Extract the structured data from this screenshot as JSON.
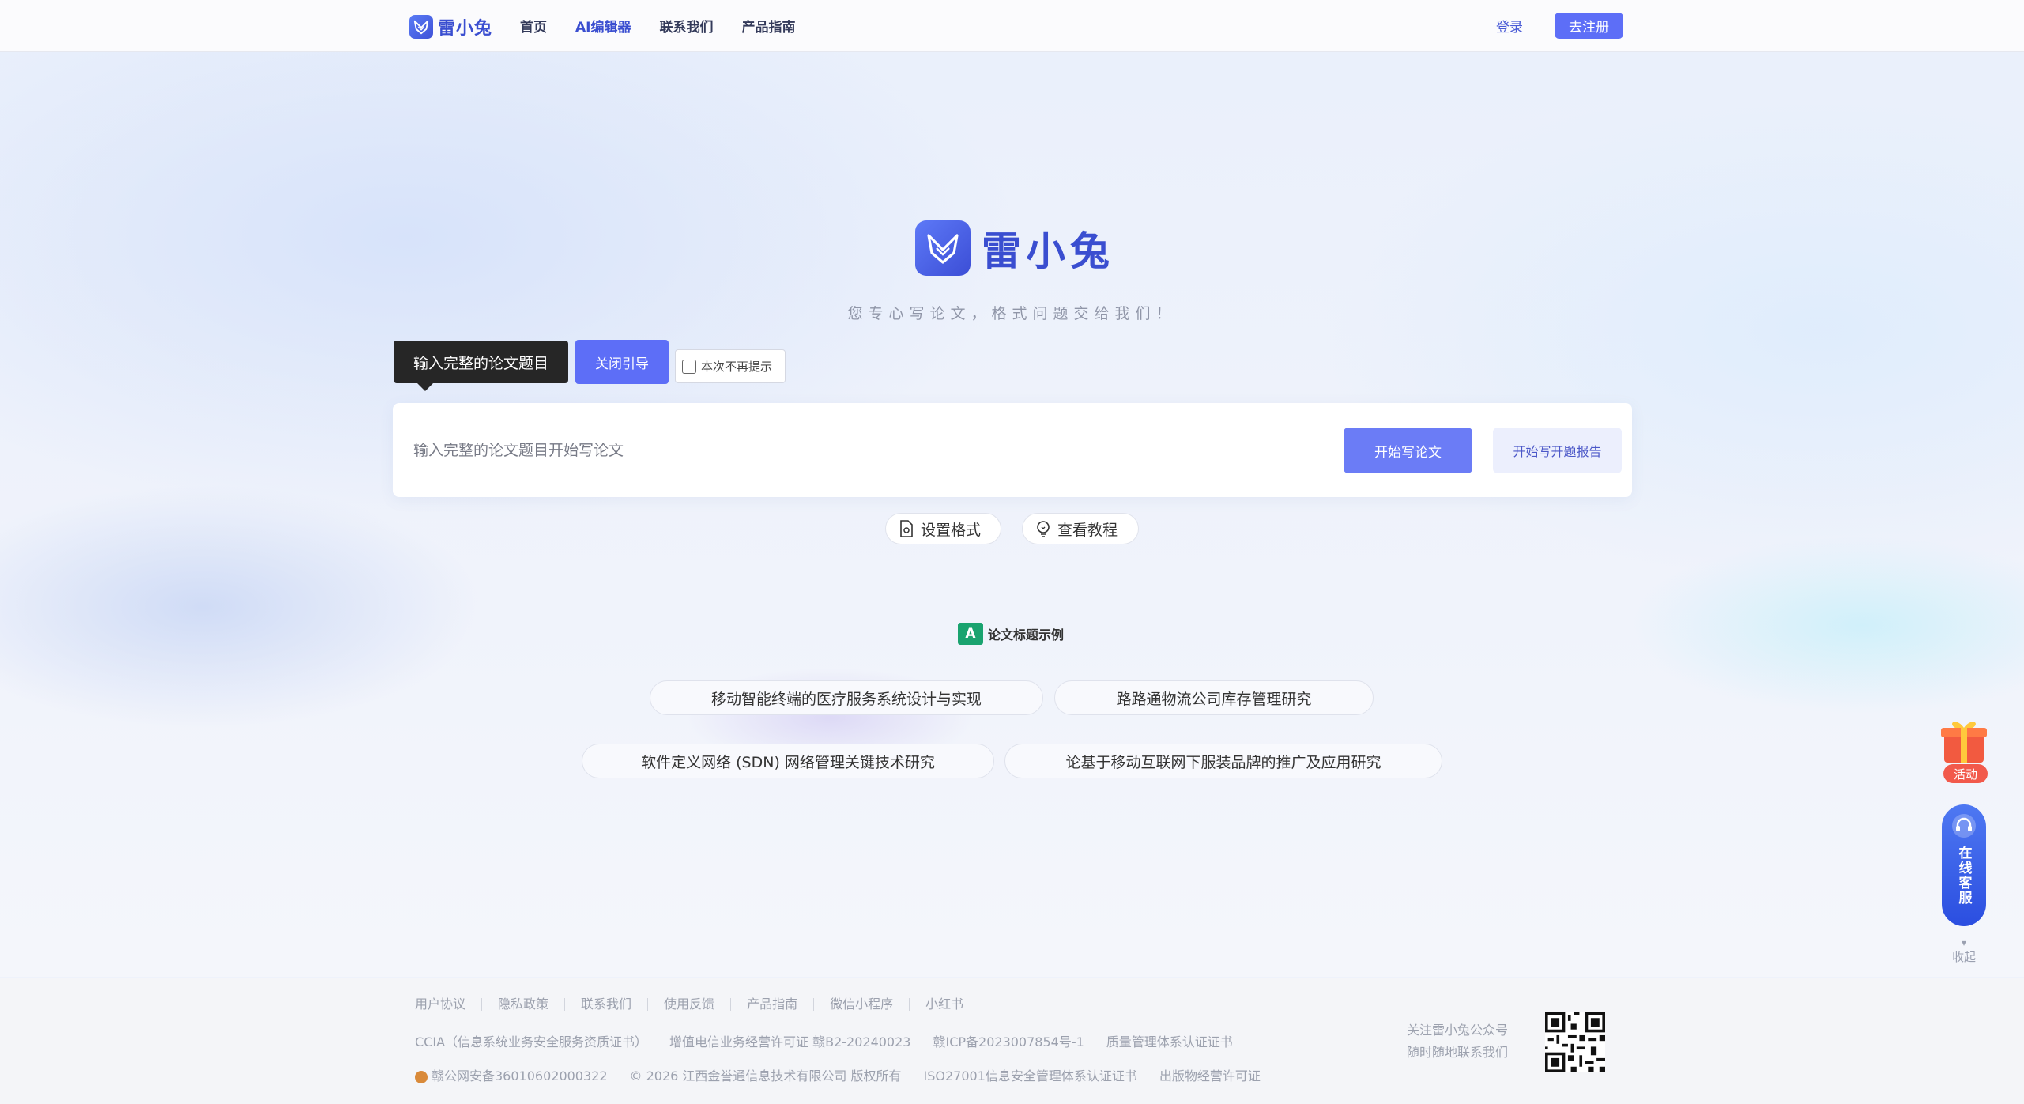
{
  "header": {
    "brand": "雷小兔",
    "nav": [
      {
        "label": "首页",
        "active": false
      },
      {
        "label": "AI编辑器",
        "active": true
      },
      {
        "label": "联系我们",
        "active": false
      },
      {
        "label": "产品指南",
        "active": false
      }
    ],
    "login": "登录",
    "register": "去注册"
  },
  "hero": {
    "brand": "雷小兔",
    "slogan": "您专心写论文，格式问题交给我们！"
  },
  "guide": {
    "tip": "输入完整的论文题目",
    "close": "关闭引导",
    "no_remind": "本次不再提示"
  },
  "search": {
    "placeholder": "输入完整的论文题目开始写论文",
    "value": "",
    "write_btn": "开始写论文",
    "report_btn": "开始写开题报告"
  },
  "actions": {
    "format": "设置格式",
    "tutorial": "查看教程"
  },
  "examples": {
    "title": "论文标题示例",
    "items": [
      "移动智能终端的医疗服务系统设计与实现",
      "路路通物流公司库存管理研究",
      "软件定义网络 (SDN) 网络管理关键技术研究",
      "论基于移动互联网下服装品牌的推广及应用研究"
    ]
  },
  "side": {
    "activity": "活动",
    "service": "在线客服",
    "collapse": "收起"
  },
  "footer": {
    "links": [
      "用户协议",
      "隐私政策",
      "联系我们",
      "使用反馈",
      "产品指南",
      "微信小程序",
      "小红书"
    ],
    "row2": [
      "CCIA（信息系统业务安全服务资质证书）",
      "增值电信业务经营许可证 赣B2-20240023",
      "赣ICP备2023007854号-1",
      "质量管理体系认证证书"
    ],
    "row3": [
      "赣公网安备36010602000322",
      "© 2026 江西金誉通信息技术有限公司 版权所有",
      "ISO27001信息安全管理体系认证证书",
      "出版物经营许可证"
    ],
    "follow_line1": "关注雷小兔公众号",
    "follow_line2": "随时随地联系我们"
  },
  "colors": {
    "primary": "#5d6ef7",
    "brand": "#3a4ed0",
    "tip_bg": "#262626",
    "example_icon": "#1aa36f",
    "activity_badge": "#f2594b"
  }
}
